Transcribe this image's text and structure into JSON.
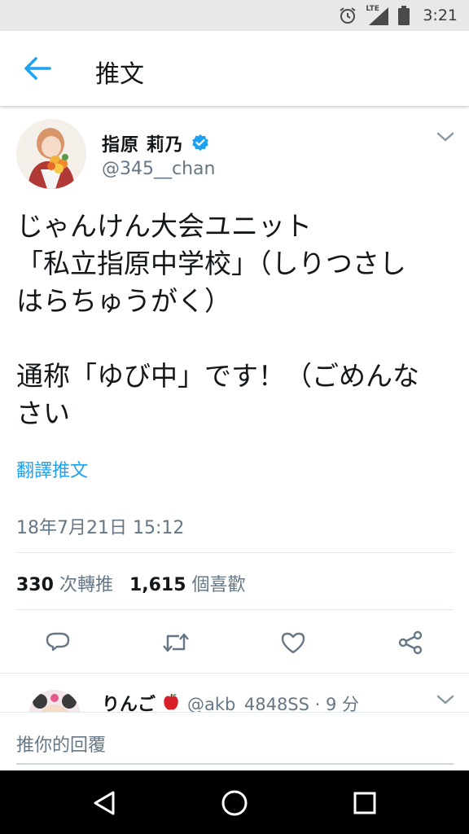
{
  "status_bar": {
    "time": "3:21",
    "network": "LTE",
    "icons": [
      "alarm-icon",
      "signal-icon",
      "battery-icon"
    ]
  },
  "app_bar": {
    "title": "推文",
    "back_icon": "arrow-left-icon"
  },
  "tweet": {
    "author_name": "指原 莉乃",
    "verified": true,
    "handle": "@345__chan",
    "text": "じゃんけん大会ユニット\n「私立指原中学校」（しりつさし\nはらちゅうがく）\n\n通称「ゆび中」です！（ごめんな\nさい",
    "translate_label": "翻譯推文",
    "timestamp": "18年7月21日 15:12",
    "retweet_count": "330",
    "retweet_label": "次轉推",
    "like_count": "1,615",
    "like_label": "個喜歡"
  },
  "actions": [
    "reply-icon",
    "retweet-icon",
    "like-icon",
    "share-icon"
  ],
  "reply_preview": {
    "name": "りんご",
    "handle": "@akb_4848SS · 9 分"
  },
  "reply_box": {
    "placeholder": "推你的回覆"
  },
  "colors": {
    "accent": "#1da1f2",
    "secondary_text": "#657786",
    "divider": "#e1e8ed"
  }
}
